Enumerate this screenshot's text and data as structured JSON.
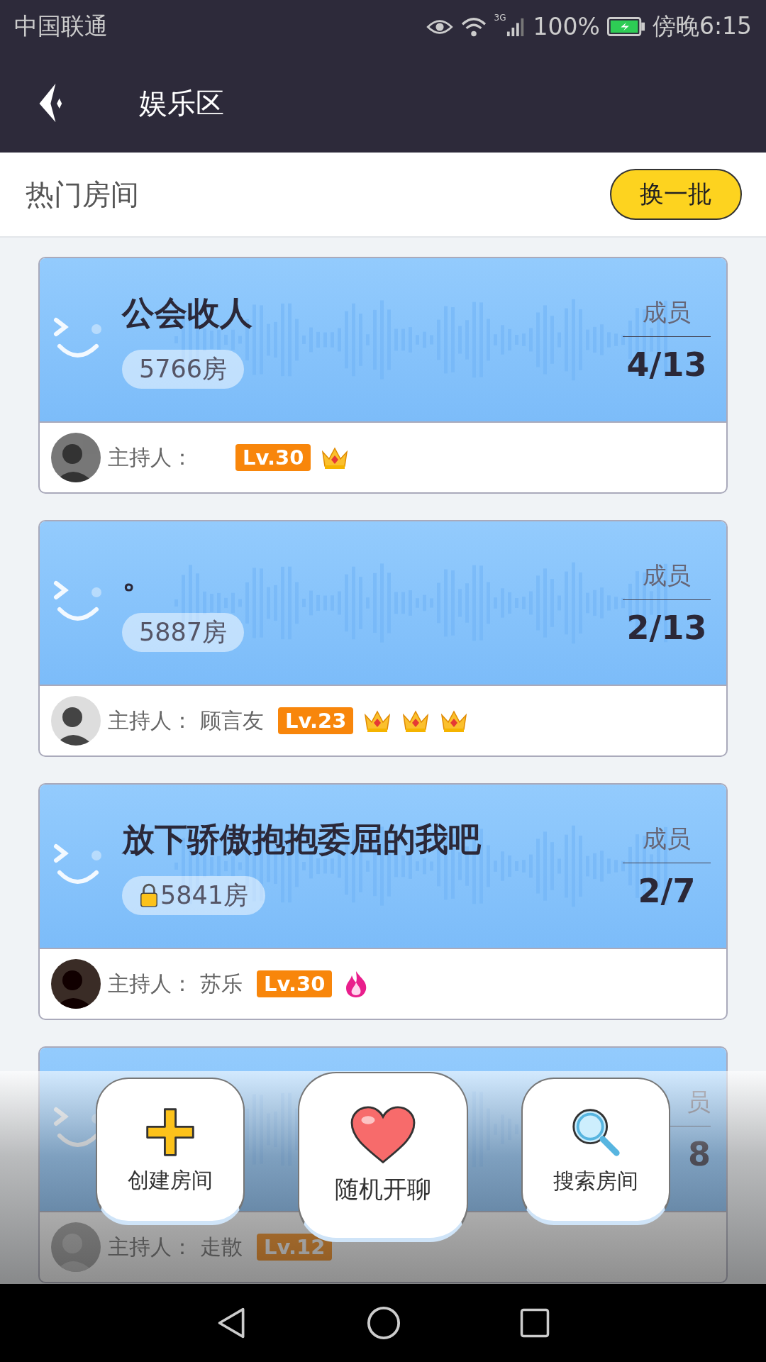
{
  "status_bar": {
    "carrier": "中国联通",
    "network": "3G",
    "battery": "100%",
    "time": "傍晚6:15"
  },
  "header": {
    "title": "娱乐区"
  },
  "section": {
    "title": "热门房间",
    "button": "换一批"
  },
  "rooms": [
    {
      "title": "公会收人",
      "room": "5766房",
      "locked": false,
      "members_label": "成员",
      "members": "4/13",
      "host_label": "主持人：",
      "level": "Lv.30",
      "badges": [
        {
          "kind": "crown"
        }
      ]
    },
    {
      "title": "。",
      "room": "5887房",
      "locked": false,
      "members_label": "成员",
      "members": "2/13",
      "host_label": "主持人：",
      "host_name": "顾言友",
      "level": "Lv.23",
      "badges": [
        {
          "kind": "crown"
        },
        {
          "kind": "crown"
        },
        {
          "kind": "crown"
        }
      ]
    },
    {
      "title": "放下骄傲抱抱委屈的我吧",
      "room": "5841房",
      "locked": true,
      "members_label": "成员",
      "members": "2/7",
      "host_label": "主持人：",
      "host_name": "苏乐",
      "level": "Lv.30",
      "badges": [
        {
          "kind": "fire"
        }
      ]
    }
  ],
  "partial_room": {
    "members_label": "员",
    "members": "8",
    "host_label": "主持人：",
    "host_name": "走散",
    "level": "Lv.12"
  },
  "actions": [
    {
      "kind": "create",
      "label": "创建房间"
    },
    {
      "kind": "random",
      "label": "随机开聊"
    },
    {
      "kind": "search",
      "label": "搜索房间"
    }
  ]
}
